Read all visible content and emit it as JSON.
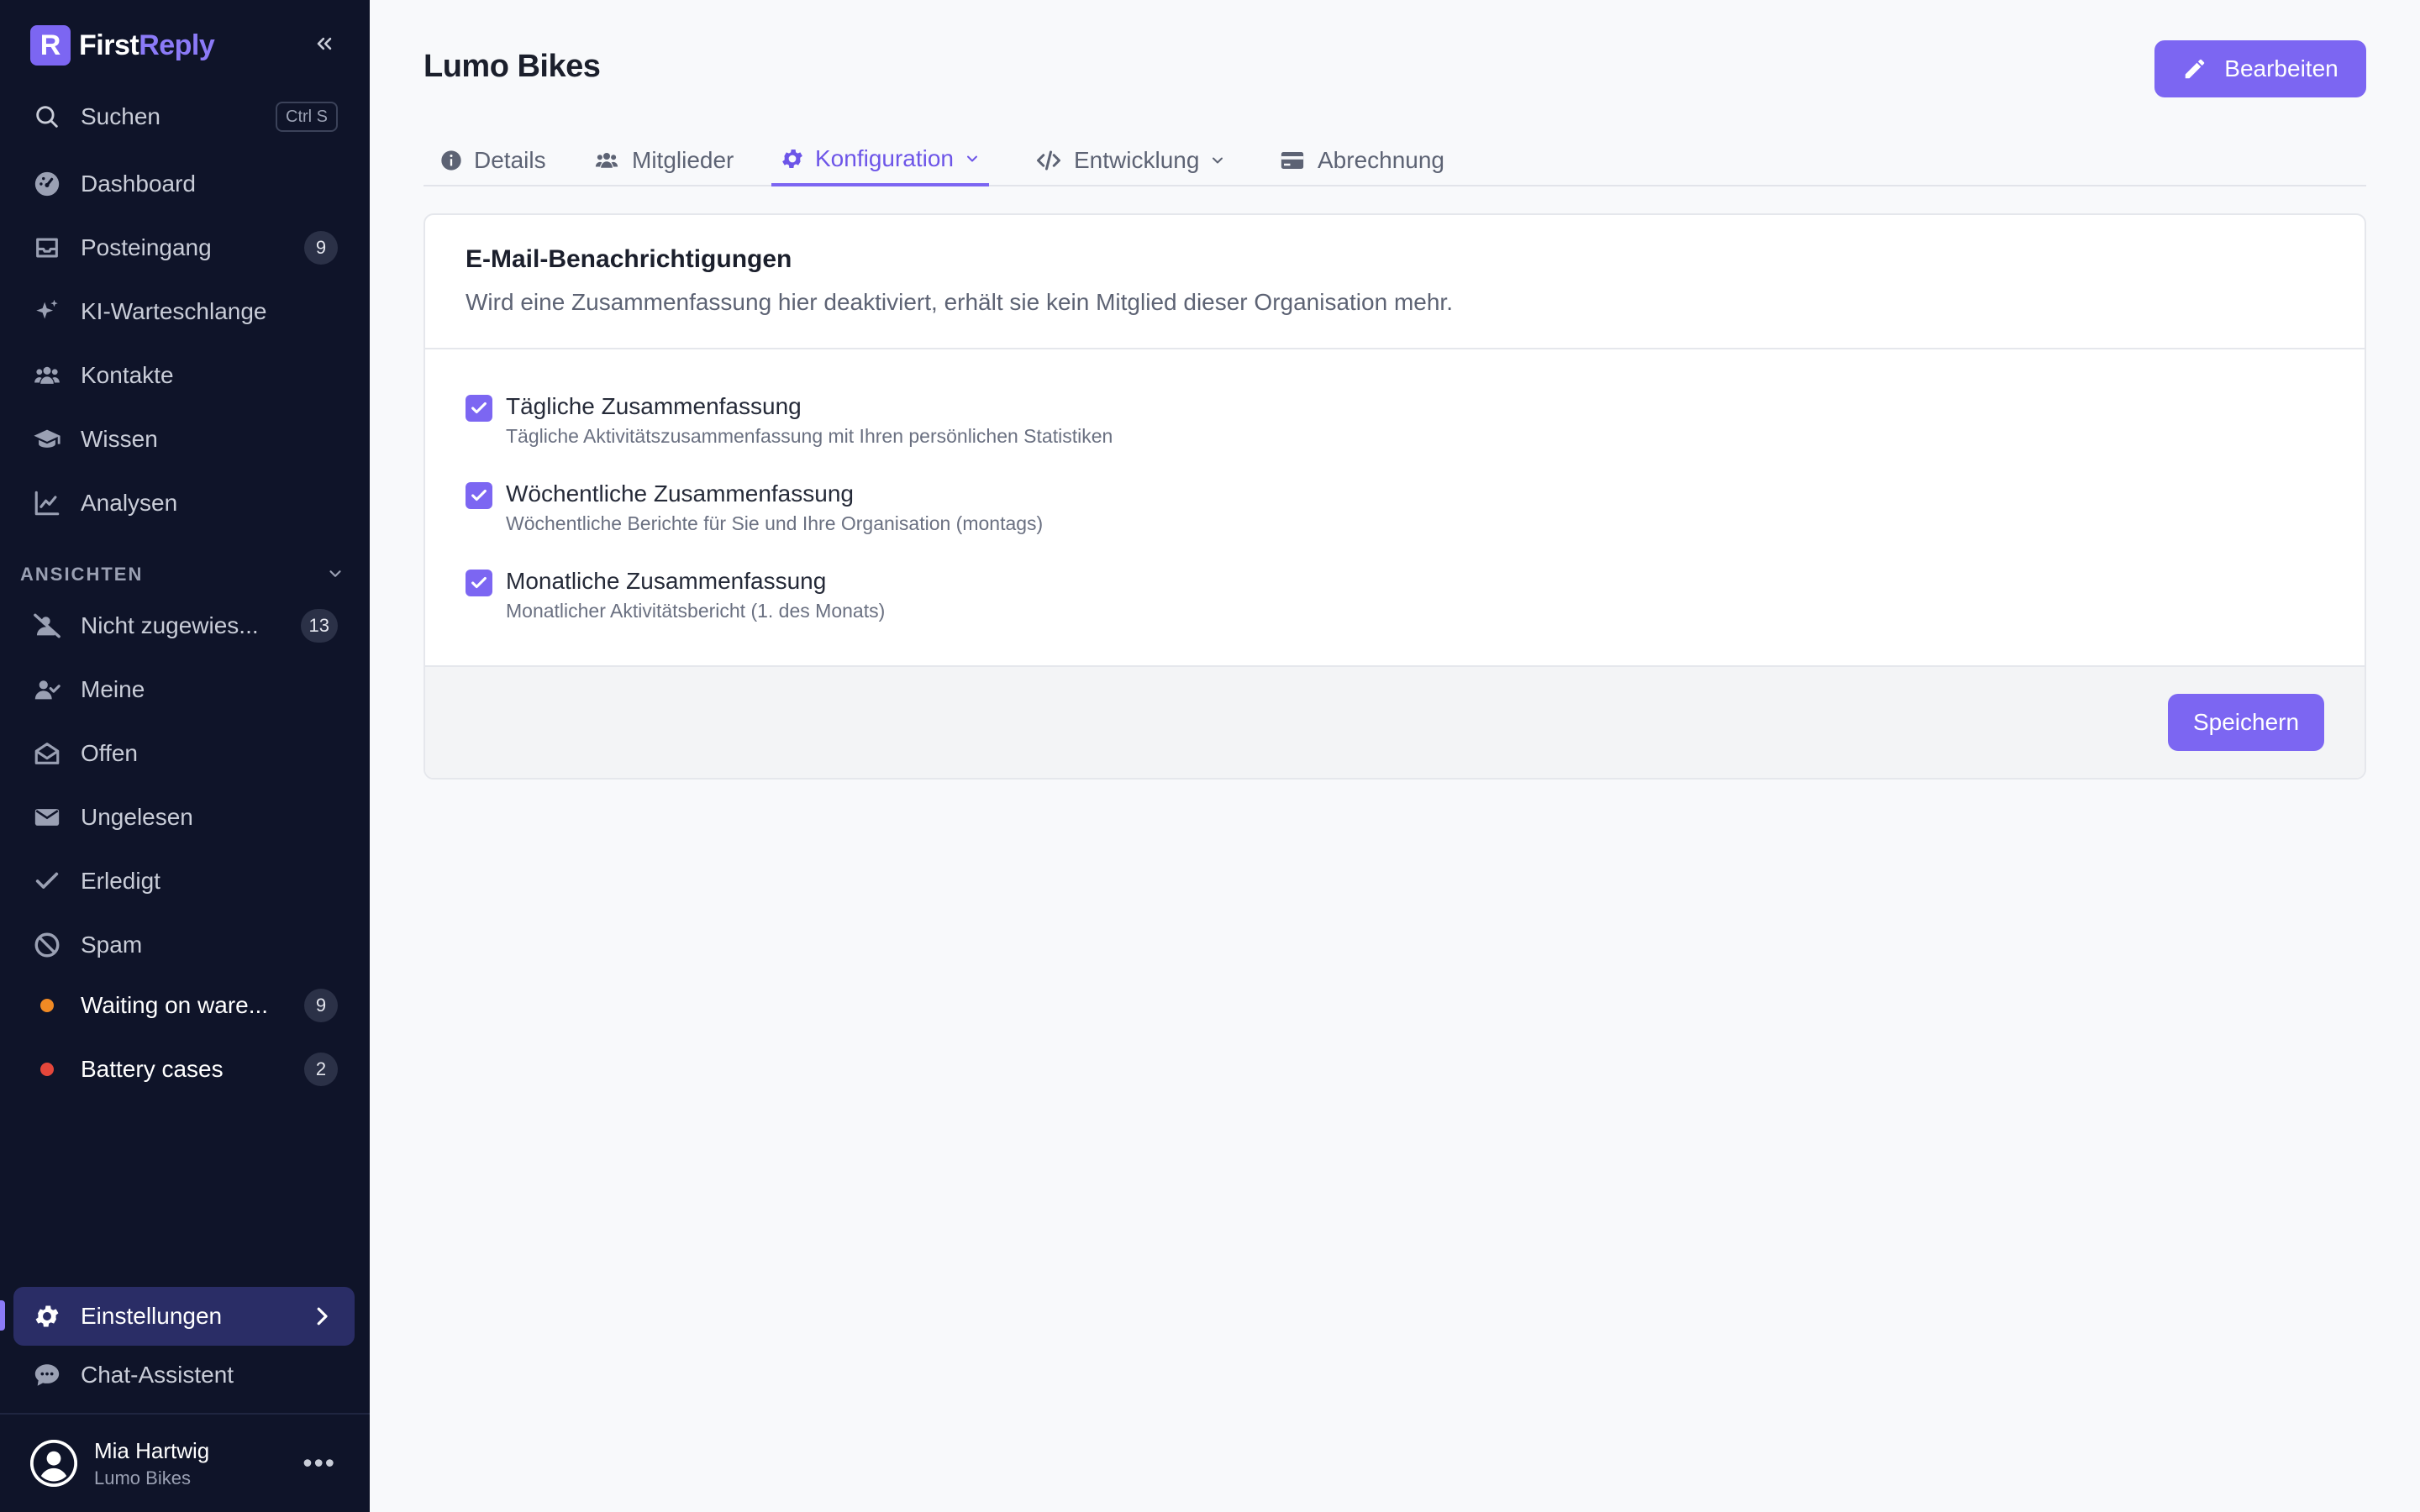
{
  "brand": {
    "name_part1": "First",
    "name_part2": "Reply",
    "logo_letter": "R"
  },
  "sidebar": {
    "search": {
      "label": "Suchen",
      "shortcut": "Ctrl S"
    },
    "items": [
      {
        "label": "Dashboard",
        "icon": "dashboard-icon"
      },
      {
        "label": "Posteingang",
        "icon": "inbox-icon",
        "badge": "9"
      },
      {
        "label": "KI-Warteschlange",
        "icon": "sparkles-icon"
      },
      {
        "label": "Kontakte",
        "icon": "users-icon"
      },
      {
        "label": "Wissen",
        "icon": "graduation-cap-icon"
      },
      {
        "label": "Analysen",
        "icon": "chart-line-icon"
      }
    ],
    "views_label": "ANSICHTEN",
    "views": [
      {
        "label": "Nicht zugewies...",
        "icon": "user-slash-icon",
        "badge": "13"
      },
      {
        "label": "Meine",
        "icon": "user-check-icon"
      },
      {
        "label": "Offen",
        "icon": "envelope-open-icon"
      },
      {
        "label": "Ungelesen",
        "icon": "envelope-icon"
      },
      {
        "label": "Erledigt",
        "icon": "check-icon"
      },
      {
        "label": "Spam",
        "icon": "ban-icon"
      },
      {
        "label": "Waiting on ware...",
        "dot_color": "#f08a24",
        "badge": "9"
      },
      {
        "label": "Battery cases",
        "dot_color": "#e5473b",
        "badge": "2"
      }
    ],
    "settings_label": "Einstellungen",
    "chat_label": "Chat-Assistent",
    "user": {
      "name": "Mia Hartwig",
      "org": "Lumo Bikes"
    }
  },
  "main": {
    "title": "Lumo Bikes",
    "edit_label": "Bearbeiten",
    "tabs": [
      {
        "label": "Details",
        "icon": "info-circle-icon"
      },
      {
        "label": "Mitglieder",
        "icon": "users-icon"
      },
      {
        "label": "Konfiguration",
        "icon": "gear-icon",
        "active": true
      },
      {
        "label": "Entwicklung",
        "icon": "code-icon"
      },
      {
        "label": "Abrechnung",
        "icon": "credit-card-icon"
      }
    ],
    "card": {
      "title": "E-Mail-Benachrichtigungen",
      "description": "Wird eine Zusammenfassung hier deaktiviert, erhält sie kein Mitglied dieser Organisation mehr.",
      "options": [
        {
          "title": "Tägliche Zusammenfassung",
          "description": "Tägliche Aktivitätszusammenfassung mit Ihren persönlichen Statistiken",
          "checked": true
        },
        {
          "title": "Wöchentliche Zusammenfassung",
          "description": "Wöchentliche Berichte für Sie und Ihre Organisation (montags)",
          "checked": true
        },
        {
          "title": "Monatliche Zusammenfassung",
          "description": "Monatlicher Aktivitätsbericht (1. des Monats)",
          "checked": true
        }
      ],
      "save_label": "Speichern"
    }
  },
  "colors": {
    "accent": "#7c66f2",
    "sidebar_bg": "#0f1429",
    "active_item_bg": "#2a2d66"
  }
}
